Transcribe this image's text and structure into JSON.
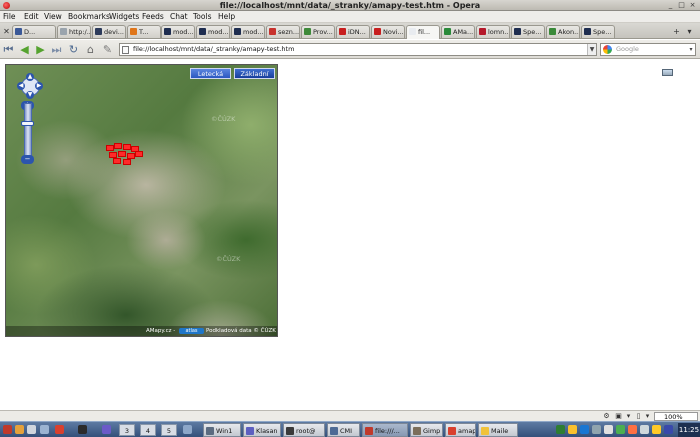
{
  "window": {
    "title": "file://localhost/mnt/data/_stranky/amapy-test.htm - Opera",
    "controls": [
      "_",
      "□",
      "×"
    ]
  },
  "menu": {
    "items": [
      "File",
      "Edit",
      "View",
      "Bookmarks",
      "Widgets",
      "Feeds",
      "Chat",
      "Tools",
      "Help"
    ]
  },
  "tabs": {
    "items": [
      {
        "label": "D...",
        "color": "#3b5998"
      },
      {
        "label": "http:/...",
        "color": "#9aa4ad"
      },
      {
        "label": "devi...",
        "color": "#2d3b5b"
      },
      {
        "label": "T...",
        "color": "#e0761a"
      },
      {
        "label": "mod...",
        "color": "#1e2d50"
      },
      {
        "label": "mod...",
        "color": "#1e2d50"
      },
      {
        "label": "mod...",
        "color": "#1e2d50"
      },
      {
        "label": "sezn...",
        "color": "#c8322d"
      },
      {
        "label": "Prov...",
        "color": "#3e8a3a"
      },
      {
        "label": "iDN...",
        "color": "#c81e1e"
      },
      {
        "label": "Novi...",
        "color": "#c81e1e"
      },
      {
        "label": "fil...",
        "color": "#e9ecf0"
      },
      {
        "label": "AMa...",
        "color": "#2a8a3a"
      },
      {
        "label": "lomn...",
        "color": "#b5182a"
      },
      {
        "label": "Spe...",
        "color": "#1e2d50"
      },
      {
        "label": "Akon...",
        "color": "#3a8a3a"
      },
      {
        "label": "Spe...",
        "color": "#1e2d50"
      }
    ],
    "active_index": 11,
    "add_label": "+",
    "menu_label": "▾"
  },
  "toolbar": {
    "url": "file://localhost/mnt/data/_stranky/amapy-test.htm",
    "search_placeholder": "Google"
  },
  "map": {
    "type_buttons": [
      "Letecká",
      "Základní"
    ],
    "watermark": "©ČÚZK",
    "footer_left": "AMapy.cz -",
    "footer_badge": "atlas",
    "footer_right": "Podkladová data © ČÚZK"
  },
  "statusbar": {
    "zoom": "100%"
  },
  "taskbar": {
    "desktops": [
      "3",
      "4",
      "5"
    ],
    "tasks": [
      "Win1",
      "Klasan",
      "root@",
      "CMI",
      "file:///...",
      "Gimp",
      "amap",
      "Maile"
    ],
    "clock": "11:25"
  },
  "colors": {
    "accent": "#2c55ad",
    "highlight": "#ff2a2a"
  }
}
